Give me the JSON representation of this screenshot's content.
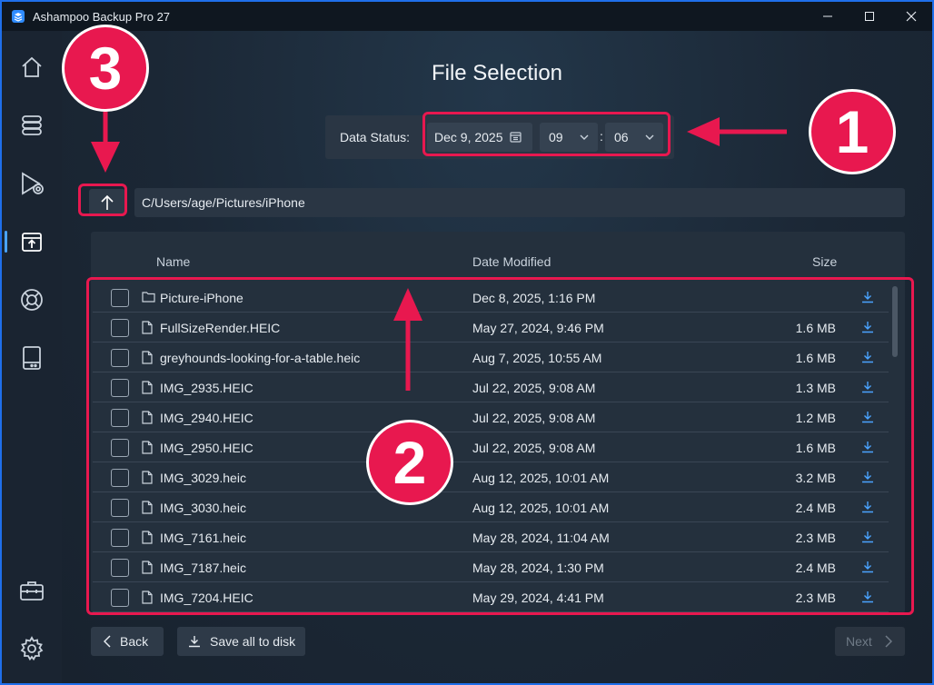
{
  "window": {
    "title": "Ashampoo Backup Pro 27"
  },
  "sidebar": {
    "items": [
      {
        "icon": "home-icon"
      },
      {
        "icon": "database-icon"
      },
      {
        "icon": "restore-play-icon"
      },
      {
        "icon": "backup-box-icon",
        "active": true
      },
      {
        "icon": "lifebuoy-icon"
      },
      {
        "icon": "drive-icon"
      },
      {
        "icon": "toolbox-icon"
      },
      {
        "icon": "gear-icon"
      }
    ]
  },
  "main": {
    "title": "File Selection",
    "data_status": {
      "label": "Data Status:",
      "date": "Dec 9, 2025",
      "hour": "09",
      "separator": ":",
      "minute": "06"
    },
    "path": "C/Users/age/Pictures/iPhone",
    "columns": {
      "name": "Name",
      "date": "Date Modified",
      "size": "Size"
    },
    "files": [
      {
        "type": "folder",
        "name": "Picture-iPhone",
        "date": "Dec 8, 2025, 1:16 PM",
        "size": ""
      },
      {
        "type": "file",
        "name": "FullSizeRender.HEIC",
        "date": "May 27, 2024, 9:46 PM",
        "size": "1.6 MB"
      },
      {
        "type": "file",
        "name": "greyhounds-looking-for-a-table.heic",
        "date": "Aug 7, 2025, 10:55 AM",
        "size": "1.6 MB"
      },
      {
        "type": "file",
        "name": "IMG_2935.HEIC",
        "date": "Jul 22, 2025, 9:08 AM",
        "size": "1.3 MB"
      },
      {
        "type": "file",
        "name": "IMG_2940.HEIC",
        "date": "Jul 22, 2025, 9:08 AM",
        "size": "1.2 MB"
      },
      {
        "type": "file",
        "name": "IMG_2950.HEIC",
        "date": "Jul 22, 2025, 9:08 AM",
        "size": "1.6 MB"
      },
      {
        "type": "file",
        "name": "IMG_3029.heic",
        "date": "Aug 12, 2025, 10:01 AM",
        "size": "3.2 MB"
      },
      {
        "type": "file",
        "name": "IMG_3030.heic",
        "date": "Aug 12, 2025, 10:01 AM",
        "size": "2.4 MB"
      },
      {
        "type": "file",
        "name": "IMG_7161.heic",
        "date": "May 28, 2024, 11:04 AM",
        "size": "2.3 MB"
      },
      {
        "type": "file",
        "name": "IMG_7187.heic",
        "date": "May 28, 2024, 1:30 PM",
        "size": "2.4 MB"
      },
      {
        "type": "file",
        "name": "IMG_7204.HEIC",
        "date": "May 29, 2024, 4:41 PM",
        "size": "2.3 MB"
      }
    ],
    "buttons": {
      "back": "Back",
      "save_all": "Save all to disk",
      "next": "Next"
    }
  },
  "annotations": {
    "badge_1": "1",
    "badge_2": "2",
    "badge_3": "3"
  },
  "colors": {
    "accent": "#4aa3ff",
    "annotation": "#e8184f"
  }
}
